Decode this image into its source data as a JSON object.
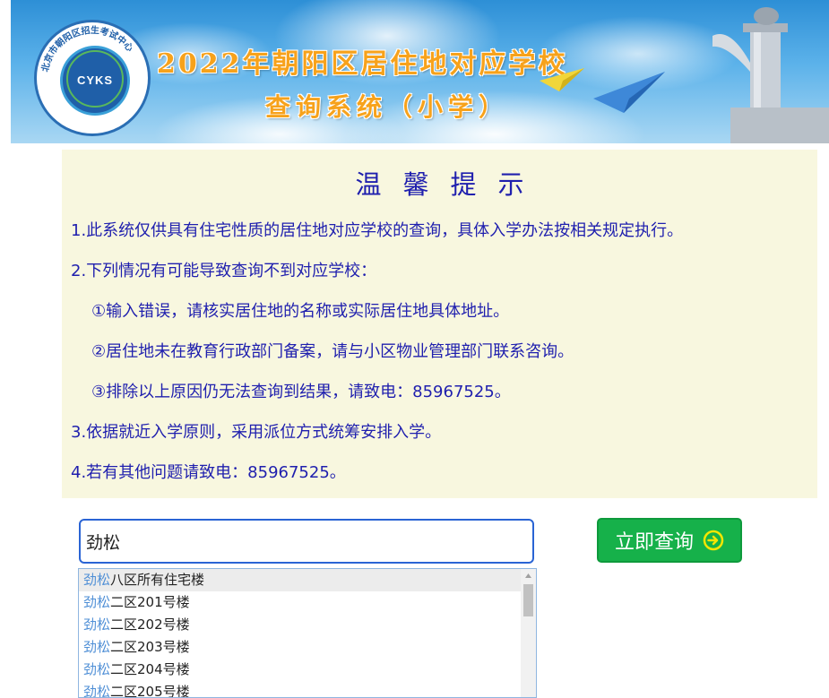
{
  "header": {
    "title_line1": "2022年朝阳区居住地对应学校",
    "title_line2": "查询系统（小学）",
    "logo": {
      "ring_text": "北京市朝阳区招生考试中心",
      "ring_text_en": "Student Recruitment & Examinations Center, Chaoyang District, Beijing",
      "letters": "CYKS"
    }
  },
  "notice": {
    "title": "温馨提示",
    "lines": [
      "1.此系统仅供具有住宅性质的居住地对应学校的查询，具体入学办法按相关规定执行。",
      "2.下列情况有可能导致查询不到对应学校：",
      "①输入错误，请核实居住地的名称或实际居住地具体地址。",
      "②居住地未在教育行政部门备案，请与小区物业管理部门联系咨询。",
      "③排除以上原因仍无法查询到结果，请致电：85967525。",
      "3.依据就近入学原则，采用派位方式统筹安排入学。",
      "4.若有其他问题请致电：85967525。"
    ]
  },
  "search": {
    "value": "劲松",
    "button_label": "立即查询"
  },
  "suggestions": {
    "match": "劲松",
    "items": [
      {
        "match": "劲松",
        "rest": "八区所有住宅楼"
      },
      {
        "match": "劲松",
        "rest": "二区201号楼"
      },
      {
        "match": "劲松",
        "rest": "二区202号楼"
      },
      {
        "match": "劲松",
        "rest": "二区203号楼"
      },
      {
        "match": "劲松",
        "rest": "二区204号楼"
      },
      {
        "match": "劲松",
        "rest": "二区205号楼"
      }
    ]
  },
  "colors": {
    "notice_text": "#1f1fae",
    "notice_bg": "#f8f7df",
    "button_bg": "#16b14a",
    "title_orange": "#f7a21b"
  }
}
